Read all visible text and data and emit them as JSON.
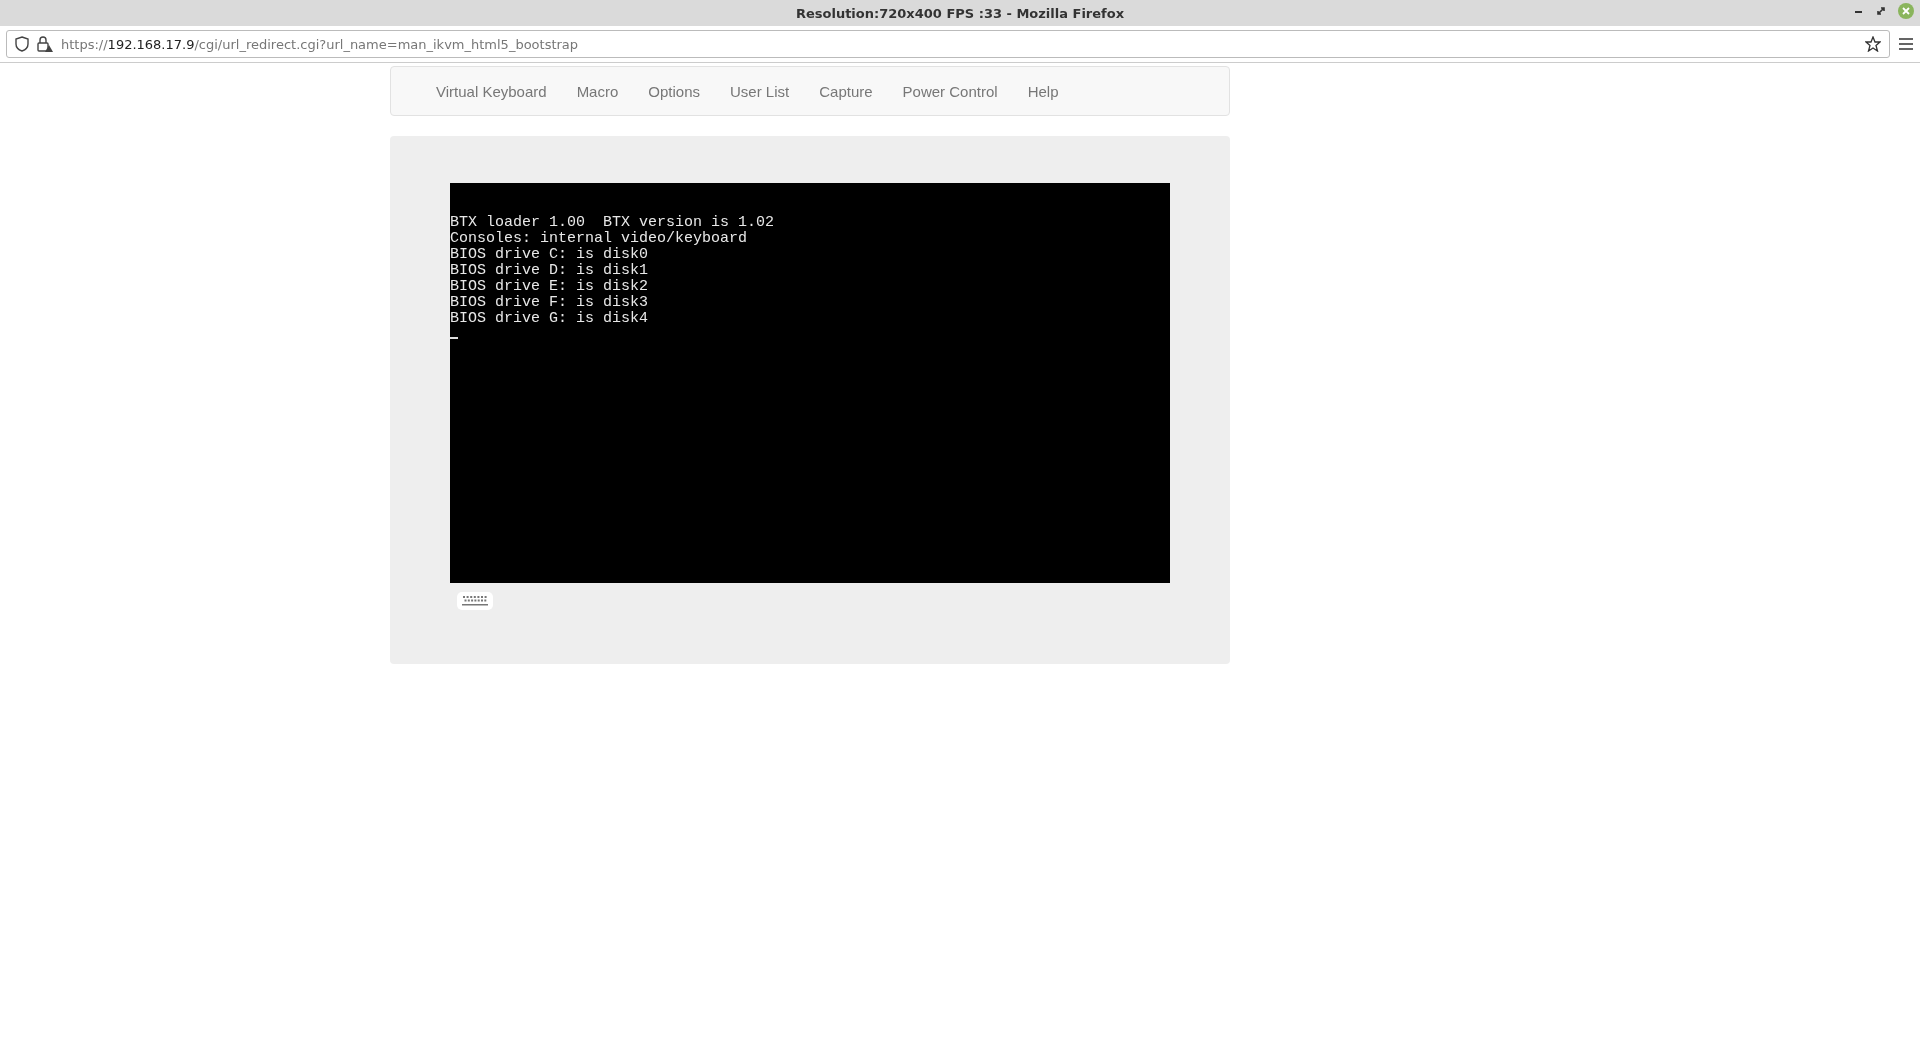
{
  "window": {
    "title": "Resolution:720x400 FPS :33 - Mozilla Firefox"
  },
  "address_bar": {
    "scheme": "https://",
    "host": "192.168.17.9",
    "path": "/cgi/url_redirect.cgi?url_name=man_ikvm_html5_bootstrap"
  },
  "menu": [
    "Virtual Keyboard",
    "Macro",
    "Options",
    "User List",
    "Capture",
    "Power Control",
    "Help"
  ],
  "console": {
    "lines": [
      "BTX loader 1.00  BTX version is 1.02",
      "Consoles: internal video/keyboard",
      "BIOS drive C: is disk0",
      "BIOS drive D: is disk1",
      "BIOS drive E: is disk2",
      "BIOS drive F: is disk3",
      "BIOS drive G: is disk4"
    ]
  }
}
